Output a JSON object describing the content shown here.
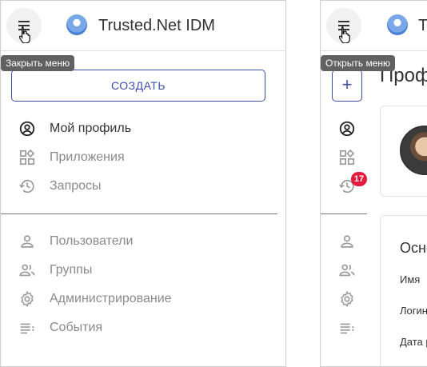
{
  "app": {
    "title": "Trusted.Net IDM",
    "title_short": "T"
  },
  "tooltips": {
    "close_menu": "Закрыть меню",
    "open_menu": "Открыть меню"
  },
  "create_button": {
    "label": "СОЗДАТЬ",
    "collapsed_symbol": "+"
  },
  "nav": {
    "main": [
      {
        "label": "Мой профиль",
        "icon": "account-circle-icon",
        "active": true
      },
      {
        "label": "Приложения",
        "icon": "apps-grid-icon",
        "active": false
      },
      {
        "label": "Запросы",
        "icon": "history-icon",
        "active": false,
        "badge": "17"
      }
    ],
    "admin": [
      {
        "label": "Пользователи",
        "icon": "person-icon"
      },
      {
        "label": "Группы",
        "icon": "group-icon"
      },
      {
        "label": "Администрирование",
        "icon": "settings-gear-icon"
      },
      {
        "label": "События",
        "icon": "events-list-icon"
      }
    ]
  },
  "profile_page": {
    "heading": "Профиль",
    "section": "Основная информация",
    "fields": [
      "Имя",
      "Логин",
      "Дата рождения"
    ]
  },
  "colors": {
    "accent": "#3c4fa8",
    "badge": "#e31b3c",
    "tooltip": "#616161"
  }
}
